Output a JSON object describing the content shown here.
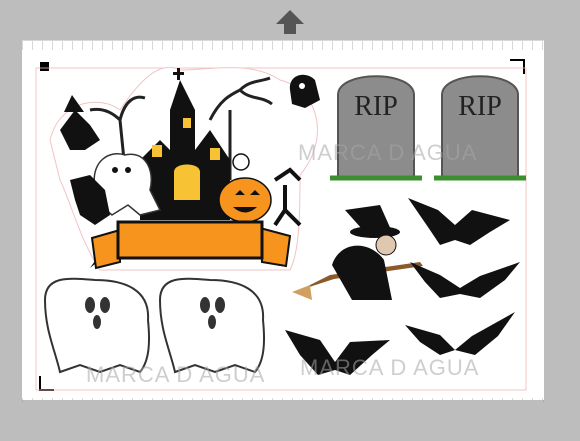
{
  "colors": {
    "mat": "#bdbdbd",
    "sheet": "#ffffff",
    "orange": "#f7941d",
    "black": "#000000",
    "gravestone": "#8c8c8c",
    "ghost": "#ffffff"
  },
  "icons": {
    "move_up": "up-arrow-icon"
  },
  "gravestones": [
    {
      "text": "RIP"
    },
    {
      "text": "RIP"
    }
  ],
  "watermarks": [
    {
      "text": "MARCA D AGUA"
    },
    {
      "text": "MARCA D AGUA"
    },
    {
      "text": "MARCA D AGUA"
    }
  ]
}
